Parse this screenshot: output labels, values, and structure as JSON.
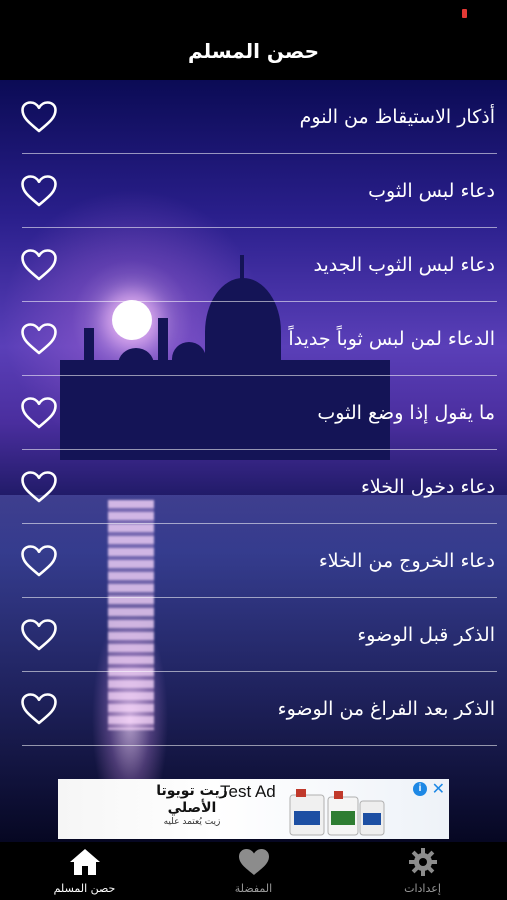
{
  "header": {
    "title": "حصن المسلم"
  },
  "list": {
    "items": [
      {
        "label": "أذكار الاستيقاظ من النوم"
      },
      {
        "label": "دعاء لبس الثوب"
      },
      {
        "label": "دعاء لبس الثوب الجديد"
      },
      {
        "label": "الدعاء لمن لبس ثوباً جديداً"
      },
      {
        "label": "ما يقول إذا وضع الثوب"
      },
      {
        "label": "دعاء دخول الخلاء"
      },
      {
        "label": "دعاء الخروج من الخلاء"
      },
      {
        "label": "الذكر قبل الوضوء"
      },
      {
        "label": "الذكر بعد الفراغ من الوضوء"
      }
    ],
    "favorite_icon": "heart-outline-icon"
  },
  "ad": {
    "brand_line1": "زيت تويوتا",
    "brand_line2": "الأصلي",
    "brand_line3": "زيت يُعتمد عليه",
    "label": "Test Ad",
    "info_icon": "i",
    "close_icon": "✕"
  },
  "tabs": [
    {
      "label": "حصن المسلم",
      "icon": "home-icon",
      "active": true
    },
    {
      "label": "المفضلة",
      "icon": "heart-icon",
      "active": false
    },
    {
      "label": "إعدادات",
      "icon": "gear-icon",
      "active": false
    }
  ],
  "colors": {
    "status_battery": "#e53935",
    "ad_accent": "#1e88e5",
    "tab_active": "#ffffff",
    "tab_inactive": "#9a9a9a"
  }
}
